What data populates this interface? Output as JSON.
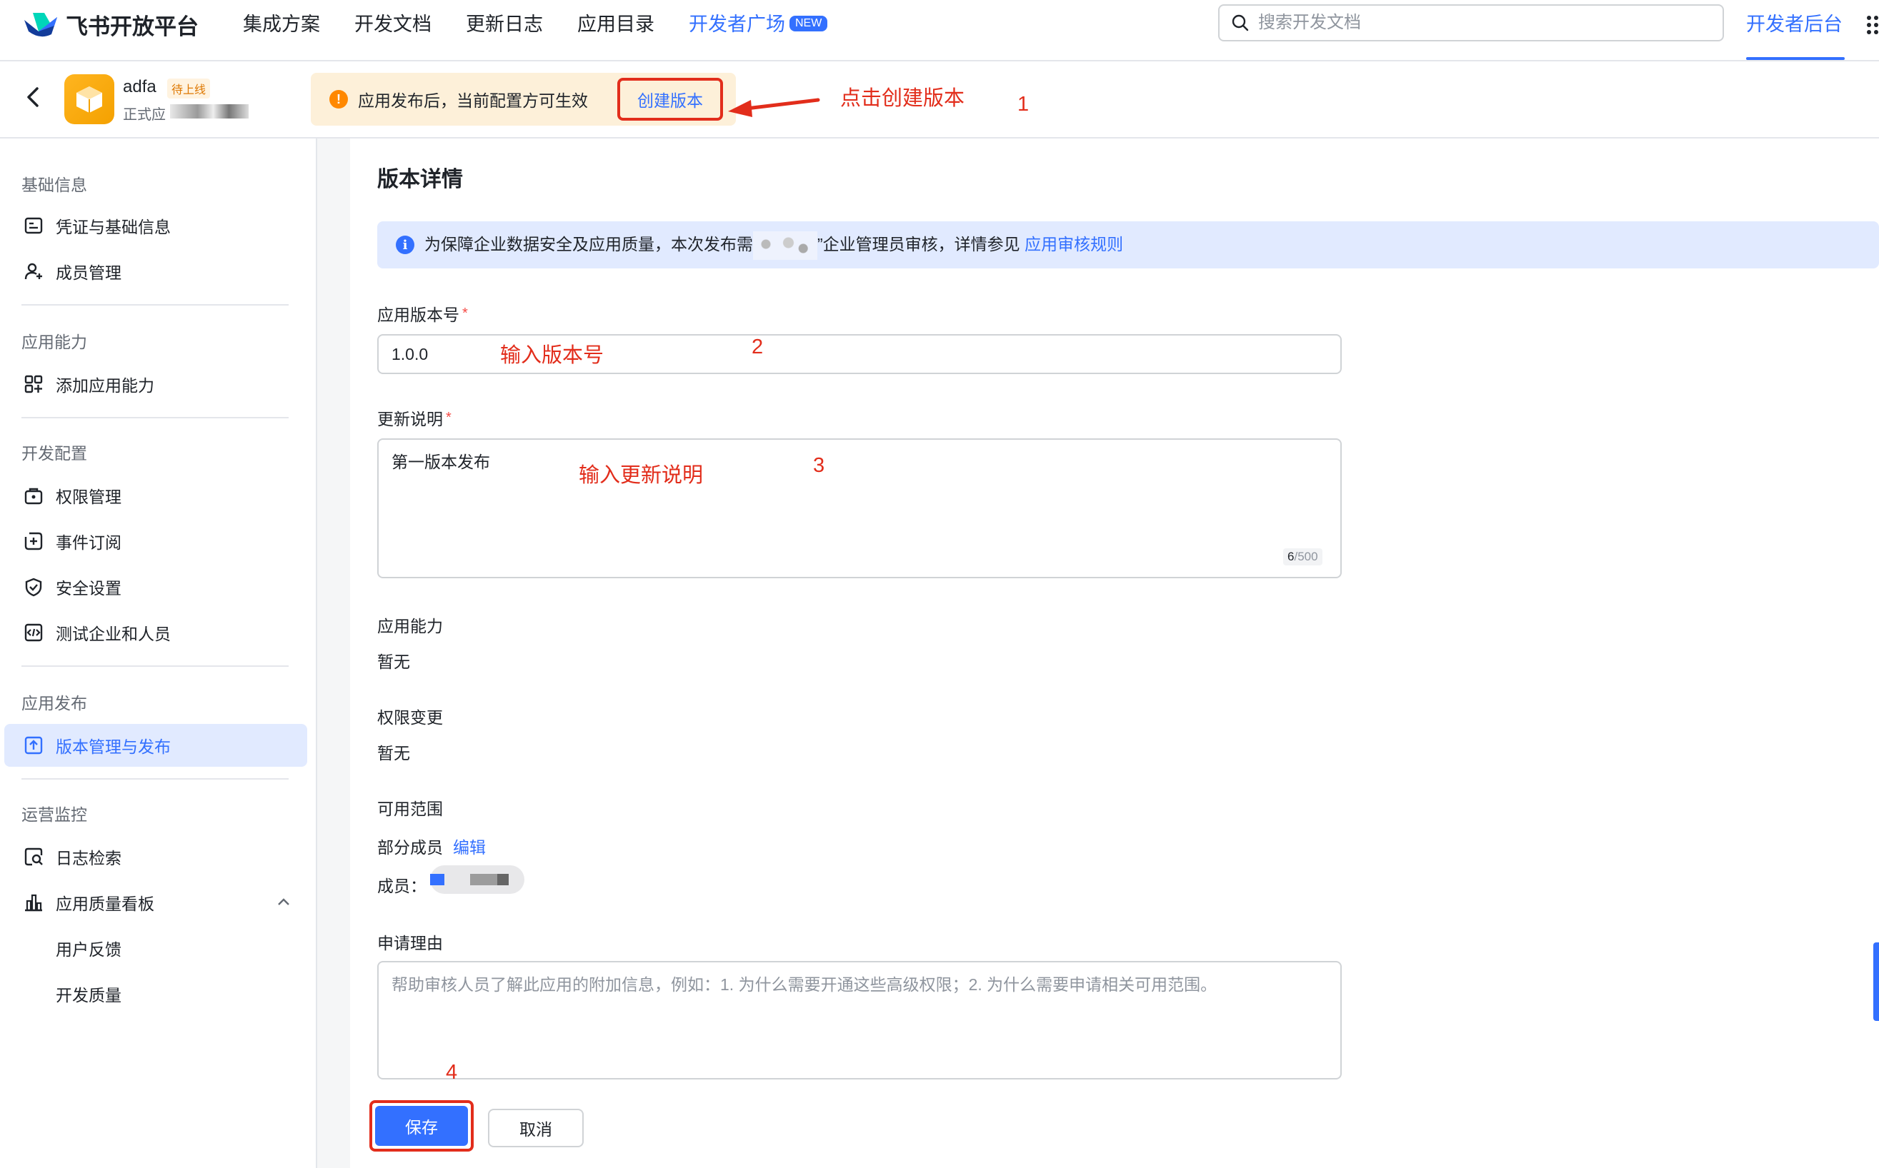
{
  "brand": {
    "name": "飞书开放平台",
    "accent": "#3370ff",
    "annotation_color": "#e22d1b"
  },
  "nav": {
    "items": [
      "集成方案",
      "开发文档",
      "更新日志",
      "应用目录"
    ],
    "plaza": "开发者广场",
    "plaza_badge": "NEW",
    "search_placeholder": "搜索开发文档",
    "console": "开发者后台"
  },
  "app": {
    "name": "adfa",
    "status_tag": "待上线",
    "type_label": "正式应",
    "notice": "应用发布后，当前配置方可生效",
    "create_version": "创建版本"
  },
  "sidebar": {
    "groups": [
      {
        "title": "基础信息",
        "items": [
          {
            "label": "凭证与基础信息",
            "icon": "credential-icon"
          },
          {
            "label": "成员管理",
            "icon": "add-member-icon"
          }
        ]
      },
      {
        "title": "应用能力",
        "items": [
          {
            "label": "添加应用能力",
            "icon": "grid-plus-icon"
          }
        ]
      },
      {
        "title": "开发配置",
        "items": [
          {
            "label": "权限管理",
            "icon": "lock-box-icon"
          },
          {
            "label": "事件订阅",
            "icon": "event-icon"
          },
          {
            "label": "安全设置",
            "icon": "shield-icon"
          },
          {
            "label": "测试企业和人员",
            "icon": "code-icon"
          }
        ]
      },
      {
        "title": "应用发布",
        "items": [
          {
            "label": "版本管理与发布",
            "icon": "upload-icon"
          }
        ]
      },
      {
        "title": "运营监控",
        "items": [
          {
            "label": "日志检索",
            "icon": "log-search-icon"
          },
          {
            "label": "应用质量看板",
            "icon": "bar-chart-icon"
          },
          {
            "label": "用户反馈"
          },
          {
            "label": "开发质量"
          }
        ]
      }
    ]
  },
  "main": {
    "title": "版本详情",
    "info_before": "为保障企业数据安全及应用质量，本次发布需",
    "info_after": "”企业管理员审核，详情参见",
    "info_link": "应用审核规则",
    "version_label": "应用版本号",
    "version_value": "1.0.0",
    "notes_label": "更新说明",
    "notes_value": "第一版本发布",
    "notes_count": "6",
    "notes_max": "/500",
    "capability_label": "应用能力",
    "capability_value": "暂无",
    "permission_label": "权限变更",
    "permission_value": "暂无",
    "scope_label": "可用范围",
    "scope_value": "部分成员",
    "scope_edit": "编辑",
    "members_label": "成员：",
    "reason_label": "申请理由",
    "reason_placeholder": "帮助审核人员了解此应用的附加信息，例如：1. 为什么需要开通这些高级权限；2. 为什么需要申请相关可用范围。",
    "save": "保存",
    "cancel": "取消"
  },
  "annotations": {
    "step1": "点击创建版本",
    "step2": "输入版本号",
    "step3": "输入更新说明",
    "n1": "1",
    "n2": "2",
    "n3": "3",
    "n4": "4"
  }
}
